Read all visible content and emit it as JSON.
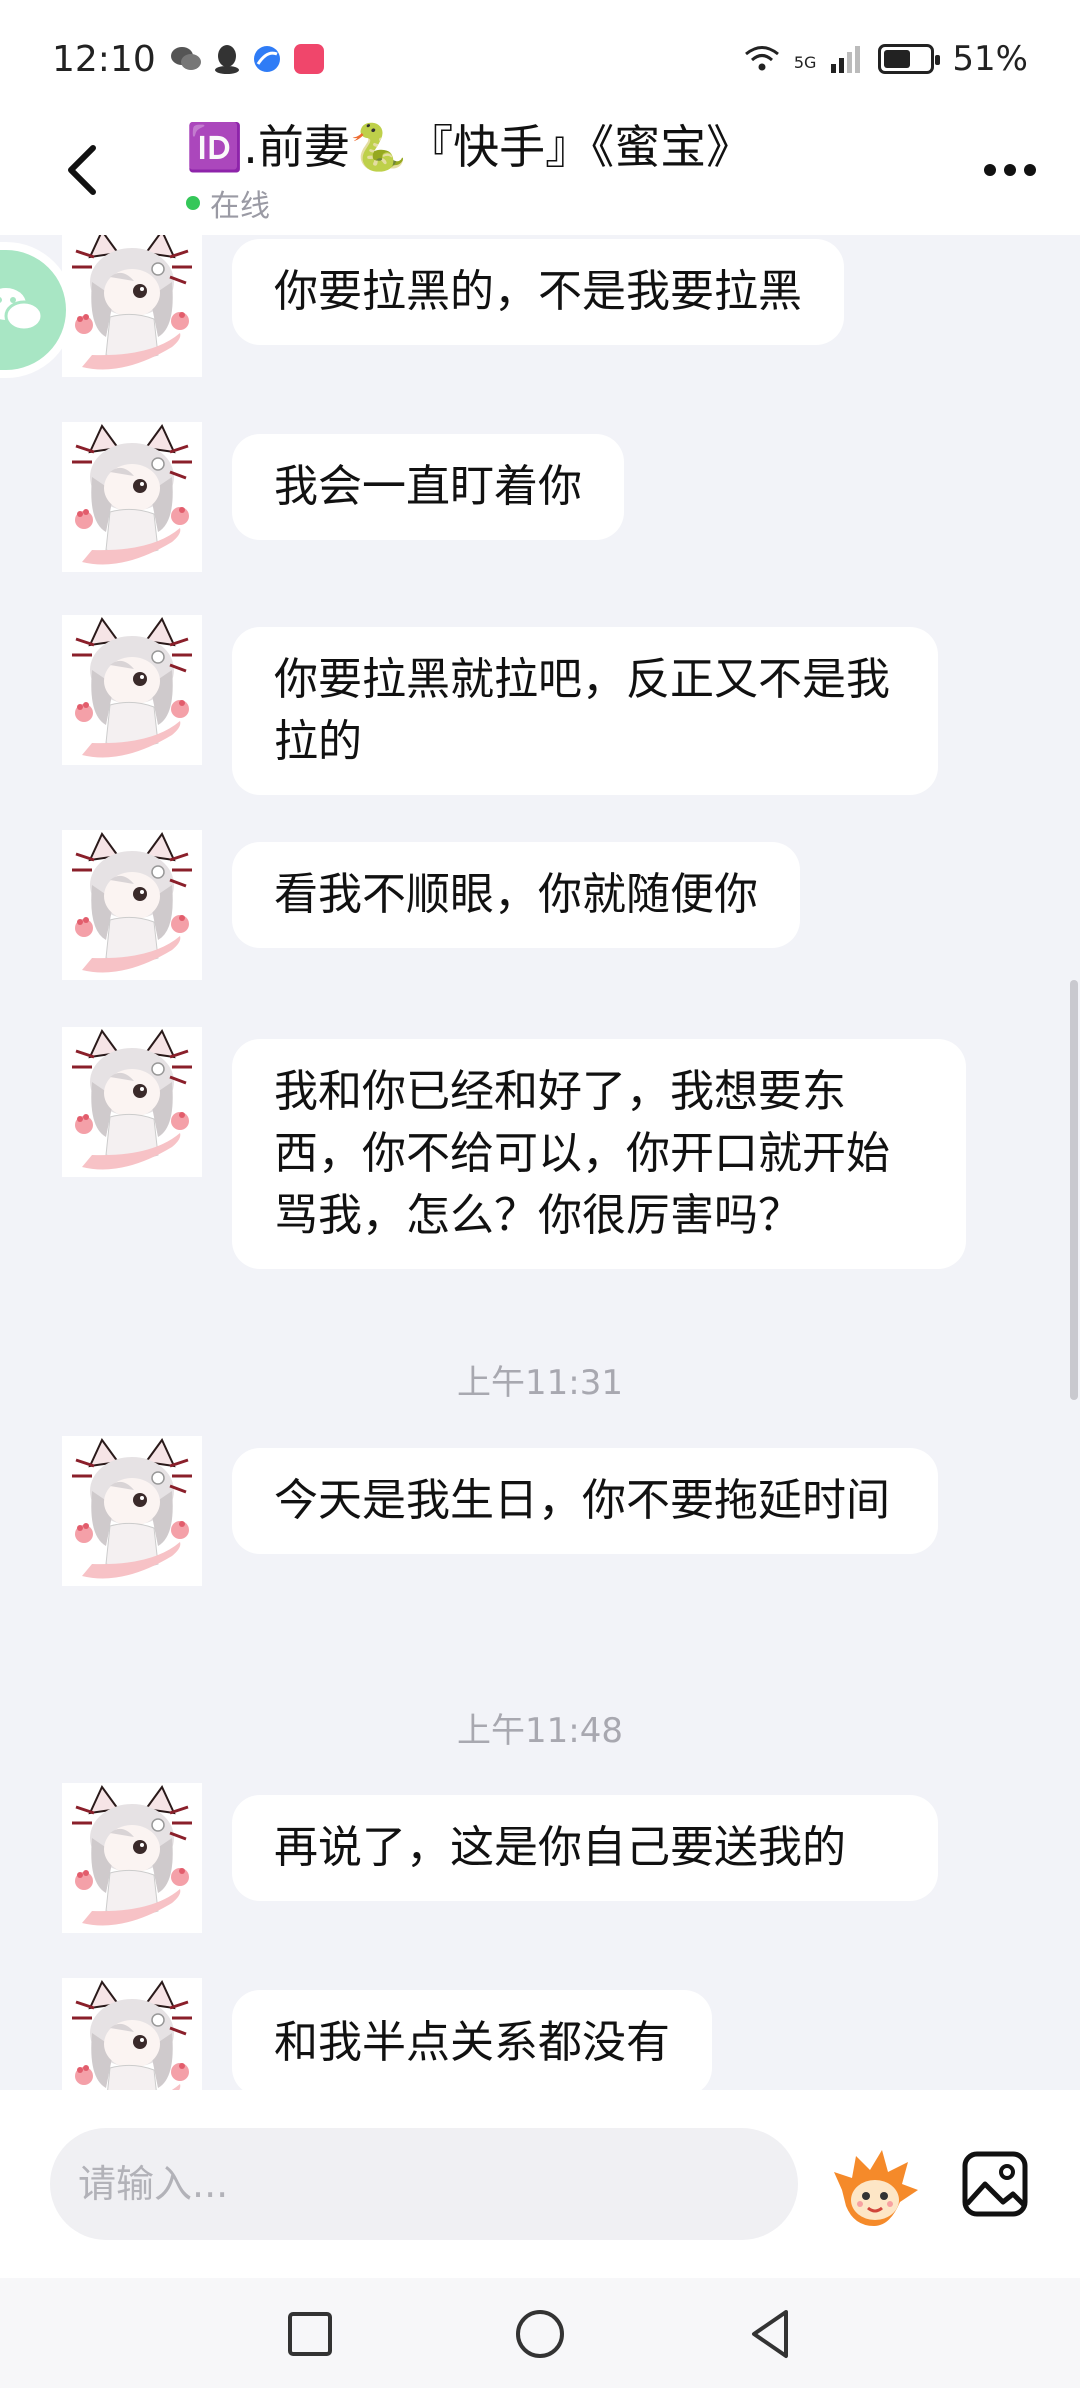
{
  "status_bar": {
    "time": "12:10",
    "network": "5G",
    "battery_percent": "51%",
    "battery_level": 0.51
  },
  "header": {
    "title": "🆔.前妻🐍『快手』《蜜宝》",
    "status": "在线"
  },
  "messages": [
    {
      "text": "你要拉黑的，不是我要拉黑"
    },
    {
      "text": "我会一直盯着你"
    },
    {
      "text": "你要拉黑就拉吧，反正又不是我拉的"
    },
    {
      "text": "看我不顺眼，你就随便你"
    },
    {
      "text": "我和你已经和好了，我想要东西，你不给可以，你开口就开始骂我，怎么？你很厉害吗？"
    },
    {
      "text": "今天是我生日，你不要拖延时间"
    },
    {
      "text": "再说了，这是你自己要送我的"
    },
    {
      "text": "和我半点关系都没有"
    }
  ],
  "timestamps": [
    "上午11:31",
    "上午11:48"
  ],
  "input": {
    "placeholder": "请输入..."
  },
  "icons": {
    "back": "back-arrow-icon",
    "more": "more-icon",
    "emoji": "emoji-icon",
    "image": "image-icon",
    "side": "wechat-icon"
  },
  "colors": {
    "online": "#35c759",
    "background": "#f2f3f8",
    "bubble": "#ffffff",
    "side_float": "#a8e6c4"
  }
}
